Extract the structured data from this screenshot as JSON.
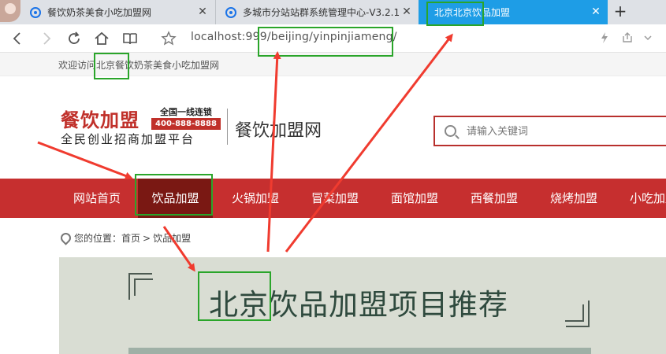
{
  "browser": {
    "tabs": [
      {
        "title": "餐饮奶茶美食小吃加盟网",
        "active": false
      },
      {
        "title": "多城市分站站群系统管理中心-V3.2.1",
        "active": false
      },
      {
        "title": "北京北京饮品加盟",
        "active": true
      }
    ],
    "tab_close_glyph": "✕",
    "new_tab_glyph": "+",
    "url_host": "localhost:999",
    "url_path": "/beijing/yinpinjiameng/",
    "welcome_text": "欢迎访问北京餐饮奶茶美食小吃加盟网"
  },
  "header": {
    "logo_title": "餐饮加盟",
    "logo_badge_top": "全国一线连锁",
    "logo_phone": "400-888-8888",
    "logo_slogan": "全民创业招商加盟平台",
    "site_name": "餐饮加盟网",
    "search_placeholder": "请输入关键词"
  },
  "nav": {
    "items": [
      {
        "label": "网站首页",
        "active": false
      },
      {
        "label": "饮品加盟",
        "active": true
      },
      {
        "label": "火锅加盟",
        "active": false
      },
      {
        "label": "冒菜加盟",
        "active": false
      },
      {
        "label": "面馆加盟",
        "active": false
      },
      {
        "label": "西餐加盟",
        "active": false
      },
      {
        "label": "烧烤加盟",
        "active": false
      },
      {
        "label": "小吃加盟",
        "active": false
      }
    ]
  },
  "breadcrumb": {
    "prefix": "您的位置：",
    "home": "首页",
    "separator": ">",
    "current": "饮品加盟"
  },
  "banner": {
    "title": "北京饮品加盟项目推荐"
  },
  "annotation": {
    "highlight_color": "#2aa52a",
    "arrow_color": "#f03b2f"
  },
  "colors": {
    "nav_bg": "#c62f2f",
    "nav_active_bg": "#7a1813",
    "active_tab_bg": "#1e9de6",
    "brand_red": "#c0302a"
  }
}
